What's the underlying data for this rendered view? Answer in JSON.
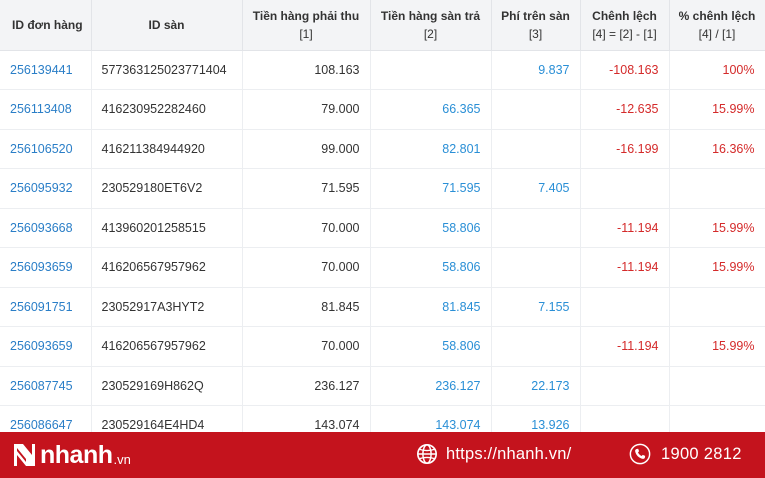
{
  "columns": {
    "order_id": "ID đơn hàng",
    "platform_id": "ID sàn",
    "receivable": "Tiền hàng phải thu",
    "receivable_ref": "[1]",
    "platform_paid": "Tiền hàng sàn trả",
    "platform_paid_ref": "[2]",
    "platform_fee": "Phí trên sàn",
    "platform_fee_ref": "[3]",
    "difference": "Chênh lệch",
    "difference_ref": "[4] = [2] - [1]",
    "pct_difference": "% chênh lệch",
    "pct_difference_ref": "[4] / [1]"
  },
  "rows": [
    {
      "order_id": "256139441",
      "platform_id": "577363125023771404",
      "receivable": "108.163",
      "platform_paid": "",
      "fee": "9.837",
      "diff": "-108.163",
      "pct": "100%"
    },
    {
      "order_id": "256113408",
      "platform_id": "416230952282460",
      "receivable": "79.000",
      "platform_paid": "66.365",
      "fee": "",
      "diff": "-12.635",
      "pct": "15.99%"
    },
    {
      "order_id": "256106520",
      "platform_id": "416211384944920",
      "receivable": "99.000",
      "platform_paid": "82.801",
      "fee": "",
      "diff": "-16.199",
      "pct": "16.36%"
    },
    {
      "order_id": "256095932",
      "platform_id": "230529180ET6V2",
      "receivable": "71.595",
      "platform_paid": "71.595",
      "fee": "7.405",
      "diff": "",
      "pct": ""
    },
    {
      "order_id": "256093668",
      "platform_id": "413960201258515",
      "receivable": "70.000",
      "platform_paid": "58.806",
      "fee": "",
      "diff": "-11.194",
      "pct": "15.99%"
    },
    {
      "order_id": "256093659",
      "platform_id": "416206567957962",
      "receivable": "70.000",
      "platform_paid": "58.806",
      "fee": "",
      "diff": "-11.194",
      "pct": "15.99%"
    },
    {
      "order_id": "256091751",
      "platform_id": "23052917A3HYT2",
      "receivable": "81.845",
      "platform_paid": "81.845",
      "fee": "7.155",
      "diff": "",
      "pct": ""
    },
    {
      "order_id": "256093659",
      "platform_id": "416206567957962",
      "receivable": "70.000",
      "platform_paid": "58.806",
      "fee": "",
      "diff": "-11.194",
      "pct": "15.99%"
    },
    {
      "order_id": "256087745",
      "platform_id": "230529169H862Q",
      "receivable": "236.127",
      "platform_paid": "236.127",
      "fee": "22.173",
      "diff": "",
      "pct": ""
    },
    {
      "order_id": "256086647",
      "platform_id": "230529164E4HD4",
      "receivable": "143.074",
      "platform_paid": "143.074",
      "fee": "13.926",
      "diff": "",
      "pct": ""
    }
  ],
  "footer": {
    "brand": "nhanh",
    "brand_suffix": ".vn",
    "website": "https://nhanh.vn/",
    "hotline": "1900 2812"
  },
  "colors": {
    "footer_bg": "#c4131d",
    "link_blue": "#2a7ec7",
    "value_blue": "#2a8fd6",
    "negative_red": "#d42a2a",
    "header_bg": "#f3f4f6"
  }
}
